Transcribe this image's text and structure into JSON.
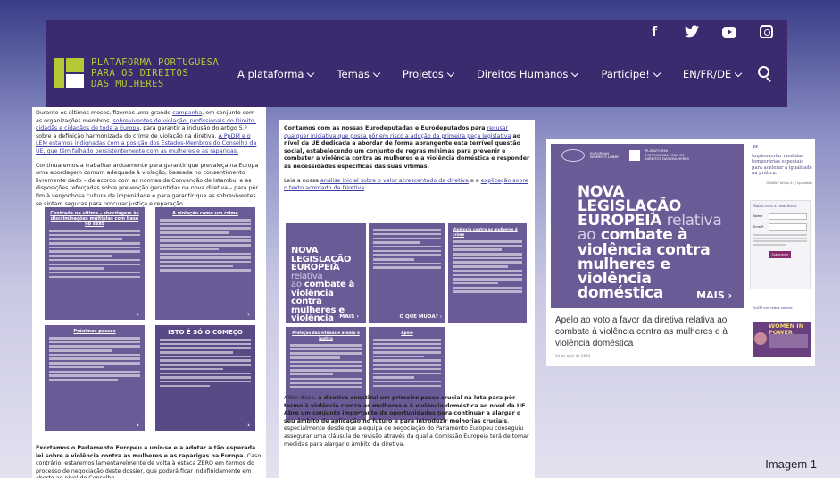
{
  "header": {
    "logo_text": [
      "PLATAFORMA PORTUGUESA",
      "PARA OS DIREITOS",
      "DAS MULHERES"
    ],
    "social_icons": [
      "facebook-icon",
      "twitter-icon",
      "youtube-icon",
      "instagram-icon"
    ],
    "nav": [
      {
        "label": "A plataforma"
      },
      {
        "label": "Temas"
      },
      {
        "label": "Projetos"
      },
      {
        "label": "Direitos Humanos"
      },
      {
        "label": "Participe!"
      },
      {
        "label": "EN/FR/DE"
      }
    ],
    "colors": {
      "header_bg": "#3b2a6d",
      "logo_green": "#b5c935",
      "card_purple": "#6a5a95"
    }
  },
  "panel1": {
    "p1_a": "Durante os últimos meses, fizemos uma grande ",
    "p1_link1": "campanha",
    "p1_b": ", em conjunto com as organizações membros, ",
    "p1_link2": "sobreviventes de violação, profissionais do Direito, cidadãs e cidadãos de toda a Europa",
    "p1_c": ", para garantir a inclusão do artigo 5.º sobre a definição harmonizada do crime de violação na diretiva. ",
    "p1_link3": "A PpDM e o LEM estamos indignadas com a posição dos Estados-Membros do Conselho da UE, que têm falhado persistentemente com as mulheres e as raparigas.",
    "p2": "Continuaremos a trabalhar arduamente para garantir que prevaleça na Europa uma abordagem comum adequada à violação, baseada no consentimento livremente dado – de acordo com as normas da Convenção de Istambul e as disposições reforçadas sobre prevenção garantidas na nova diretiva – para pôr fim à vergonhosa cultura de impunidade e para garantir que as sobreviventes se sintam seguras para procurar justiça e reparação.",
    "cards": [
      {
        "title": "Centrada na vítima - abordagem às discriminações múltiplas com base no sexo"
      },
      {
        "title": "A violação como um crime"
      },
      {
        "title": "Próximos passos"
      },
      {
        "title": "ISTO É SÓ O COMEÇO"
      }
    ],
    "p3_bold": "Exortamos o Parlamento Europeu a unir-se e a adotar a tão esperada lei sobre a violência contra as mulheres e as raparigas na Europa.",
    "p3_rest": " Caso contrário, estaremos lamentavelmente de volta à estaca ZERO em termos do processo de negociação deste dossier, que poderá ficar indefinidamente em aberto ao nível do Conselho."
  },
  "panel2": {
    "p1_a": "Contamos com as nossas Eurodeputadas e Eurodeputados para ",
    "p1_link1": "recusar qualquer iniciativa que possa pôr em risco a adoção da primeira peça legislativa",
    "p1_b": " ao nível da UE dedicada a abordar de forma abrangente esta terrível questão social, estabelecendo um conjunto de regras mínimas para prevenir e combater a violência contra as mulheres e a violência doméstica e responder às necessidades específicas das suas vítimas.",
    "p2_a": "Leia a nossa ",
    "p2_link1": "análise inicial sobre o valor acrescentado da diretiva",
    "p2_b": " e a ",
    "p2_link2": "explicação sobre o texto acordado da Diretiva",
    "p2_c": ".",
    "hero_small": {
      "l1": "NOVA",
      "l2": "LEGISLAÇÃO",
      "l3": "EUROPEIA",
      "l3b": "relativa",
      "l4": "ao",
      "l4b": "combate à",
      "l5": "violência contra",
      "l6": "mulheres e",
      "l7": "violência",
      "l8": "doméstica",
      "mais": "MAIS"
    },
    "card_mid_cta": "O QUE MUDA?",
    "card_right_title": "Violência contra as mulheres é crime",
    "card_bl_title": "Proteção das vítimas e acesso à justiça",
    "card_bm_title": "Apoio",
    "p3_a": "Além disso, ",
    "p3_bold1": "a diretiva constitui um primeiro passo crucial na luta para pôr termo à violência contra as mulheres e à violência doméstica ao nível da UE.",
    "p3_bold2": " Abre um conjunto importante de oportunidades para continuar a alargar o seu âmbito de aplicação no futuro e para introduzir melhorias cruciais",
    "p3_b": ", especialmente desde que a equipa de negociação do Parlamento Europeu conseguiu assegurar uma cláusula de revisão através da qual a Comissão Europeia terá de tomar medidas para alargar o âmbito da diretiva."
  },
  "panel3": {
    "hero": {
      "l1": "NOVA",
      "l2": "LEGISLAÇÃO",
      "l3": "EUROPEIA",
      "l3b": "relativa",
      "l4": "ao",
      "l4b": "combate à",
      "l5": "violência contra",
      "l6": "mulheres e",
      "l7": "violência",
      "l8": "doméstica",
      "mais": "MAIS"
    },
    "header_partner": "PLATAFORMA PORTUGUESA PARA OS DIREITOS DAS MULHERES",
    "header_partner2": "EUROPEAN WOMEN'S LOBBY",
    "article_title": "Apelo ao voto a favor da diretiva relativa ao combate à violência contra as mulheres e à violência doméstica",
    "article_date": "14 de abril de 2024",
    "quote": "Implementar medidas temporárias especiais para acelerar a igualdade na prática.",
    "quote_source": "CEDAW / Artigo 4.º | Igualdade",
    "newsletter_title": "Subscreva a newsletter",
    "field_name": "Nome",
    "field_email": "Email*",
    "subscribe": "Subscrever",
    "social_title": "PpDM nas redes sociais",
    "banner_text": "WOMEN IN POWER"
  },
  "caption": "Imagem 1"
}
